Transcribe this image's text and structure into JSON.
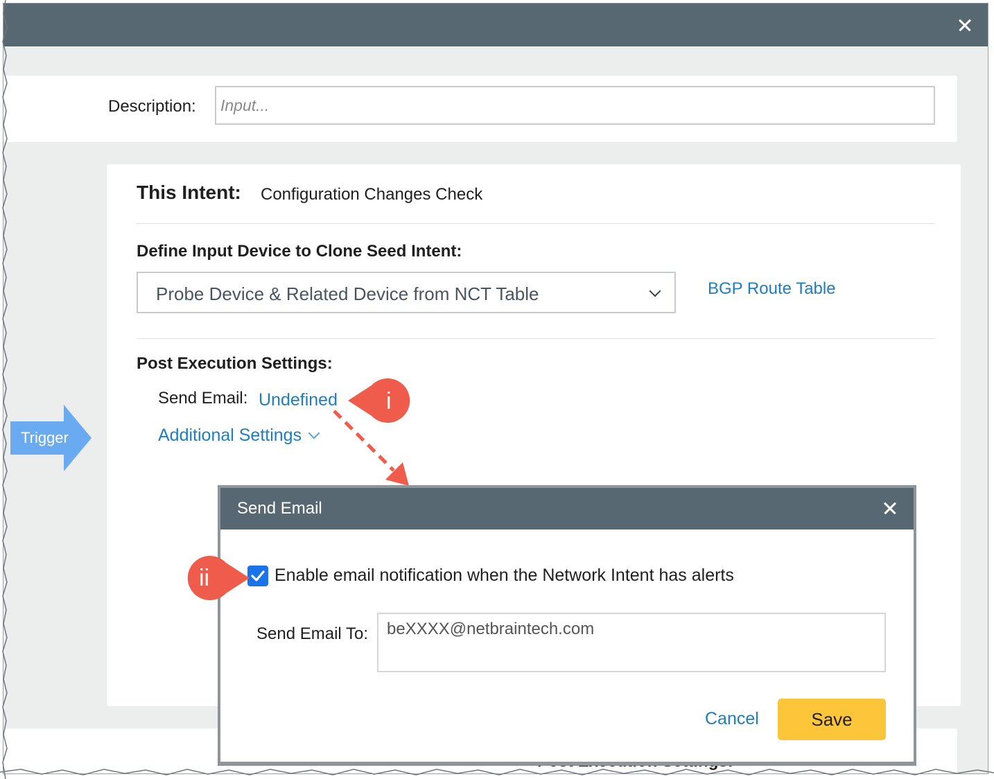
{
  "window": {
    "close_icon": "close-icon"
  },
  "description": {
    "label": "Description:",
    "placeholder": "Input..."
  },
  "intent": {
    "label": "This Intent:",
    "value": "Configuration Changes Check"
  },
  "define": {
    "label": "Define Input Device to Clone Seed Intent:",
    "selected": "Probe Device & Related Device from NCT Table",
    "link": "BGP Route Table"
  },
  "post_execution": {
    "label": "Post Execution Settings:",
    "send_email_label": "Send Email:",
    "send_email_value": "Undefined",
    "additional_settings": "Additional Settings"
  },
  "trigger": {
    "label": "Trigger",
    "color": "#6aaaf0"
  },
  "callouts": {
    "first": "i",
    "second": "ii",
    "color": "#f05c4b"
  },
  "dialog": {
    "title": "Send Email",
    "enable_label": "Enable email notification when the Network Intent has alerts",
    "enable_checked": true,
    "send_to_label": "Send Email To:",
    "send_to_value": "beXXXX@netbraintech.com",
    "cancel": "Cancel",
    "save": "Save"
  },
  "bottom": {
    "partial_text": "Post Execution Settings:"
  },
  "colors": {
    "header": "#586872",
    "link": "#1f7dc1",
    "save": "#fcc53a",
    "checkbox": "#1a73e8"
  }
}
